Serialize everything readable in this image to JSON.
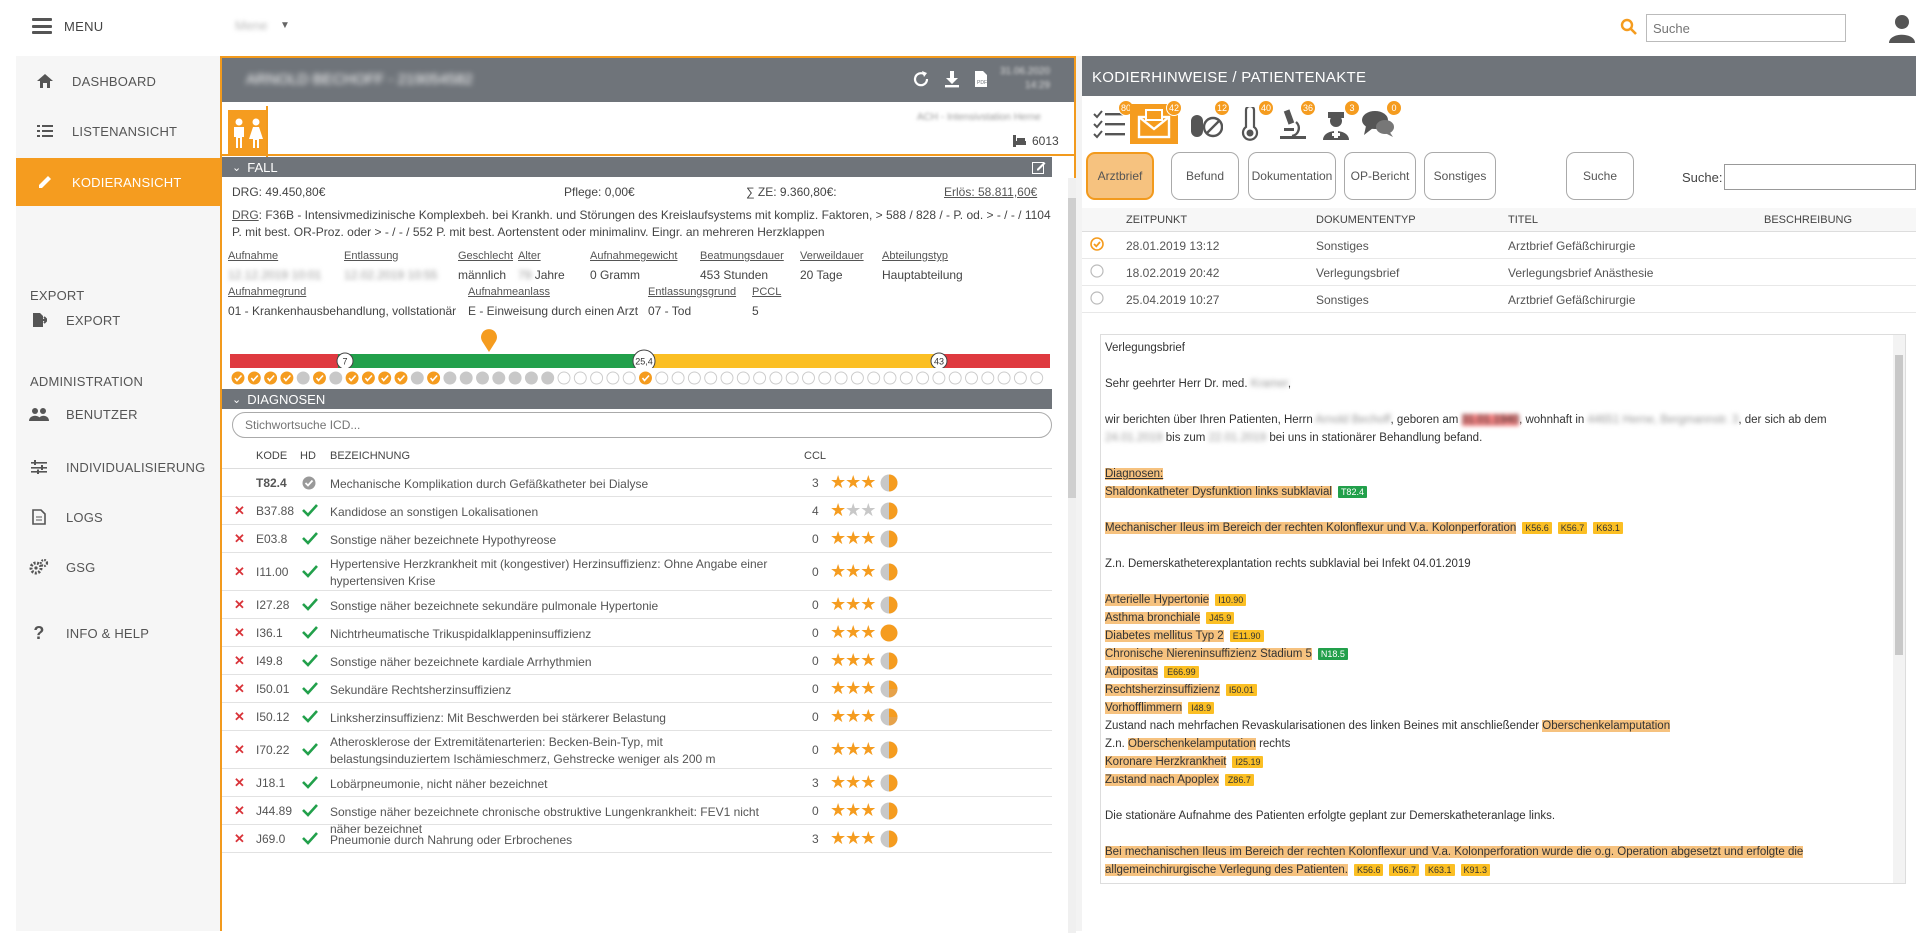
{
  "topbar": {
    "menu_label": "MENU",
    "tenant": "Mene",
    "search_placeholder": "Suche"
  },
  "sidebar": {
    "items": [
      {
        "label": "DASHBOARD",
        "icon": "home-icon"
      },
      {
        "label": "LISTENANSICHT",
        "icon": "list-icon"
      },
      {
        "label": "KODIERANSICHT",
        "icon": "pencil-icon"
      }
    ],
    "export_section": "EXPORT",
    "export_item": "EXPORT",
    "admin_section": "ADMINISTRATION",
    "admin_items": [
      {
        "label": "BENUTZER",
        "icon": "users-icon"
      },
      {
        "label": "INDIVIDUALISIERUNG",
        "icon": "sliders-icon"
      },
      {
        "label": "LOGS",
        "icon": "document-icon"
      },
      {
        "label": "GSG",
        "icon": "gears-icon"
      }
    ],
    "info_item": "INFO & HELP"
  },
  "patient": {
    "name": "ARNOLD BECHOFF - 219054582",
    "date": "31.06.2020",
    "time": "14:29",
    "station": "ACH - Intensivstation Herne",
    "bed": "6013"
  },
  "fall": {
    "section_title": "FALL",
    "drg": "DRG: 49.450,80€",
    "pflege": "Pflege: 0,00€",
    "ze": "∑ ZE: 9.360,80€:",
    "erloes": "Erlös: 58.811,60€",
    "drg_prefix": "DRG",
    "drg_desc": ": F36B - Intensivmedizinische Komplexbeh. bei Krankh. und Störungen des Kreislaufsystems mit kompliz. Faktoren, > 588 / 828 / - P. od. > - / - / 1104 P. mit best. OR-Proz. oder > - / - / 552 P. mit best. Aortenstent oder minimalinv. Eingr. an mehreren Herzklappen",
    "fields": [
      {
        "label": "Aufnahme",
        "value": "12.12.2019 10:01"
      },
      {
        "label": "Entlassung",
        "value": "12.02.2019 10:55"
      },
      {
        "label": "Geschlecht",
        "value": "männlich"
      },
      {
        "label": "Alter",
        "value": "79"
      },
      {
        "label": "Aufnahmegewicht",
        "value": "0 Gramm"
      },
      {
        "label": "Beatmungsdauer",
        "value": "453 Stunden"
      },
      {
        "label": "Verweildauer",
        "value": "20 Tage"
      },
      {
        "label": "Abteilungstyp",
        "value": "Hauptabteilung"
      },
      {
        "label": "Aufnahmegrund",
        "value": "01 - Krankenhausbehandlung, vollstationär"
      },
      {
        "label": "Aufnahmeanlass",
        "value": "E - Einweisung durch einen Arzt"
      },
      {
        "label": "Entlassungsgrund",
        "value": "07 - Tod"
      },
      {
        "label": "PCCL",
        "value": "5"
      }
    ],
    "age_unit": "Jahre",
    "scale": {
      "low": "7",
      "mid": "25,4",
      "high": "43",
      "marker_day": 20
    }
  },
  "diagnosen": {
    "section_title": "DIAGNOSEN",
    "search_placeholder": "Stichwortsuche ICD...",
    "headers": [
      "KODE",
      "HD",
      "BEZEICHNUNG",
      "CCL"
    ],
    "rows": [
      {
        "code": "T82.4",
        "desc": "Mechanische Komplikation durch Gefäßkatheter bei Dialyse",
        "ccl": "3",
        "stars": 3,
        "hd": true
      },
      {
        "code": "B37.88",
        "desc": "Kandidose an sonstigen Lokalisationen",
        "ccl": "4",
        "stars": 1
      },
      {
        "code": "E03.8",
        "desc": "Sonstige näher bezeichnete Hypothyreose",
        "ccl": "0",
        "stars": 3
      },
      {
        "code": "I11.00",
        "desc": "Hypertensive Herzkrankheit mit (kongestiver) Herzinsuffizienz: Ohne Angabe einer hypertensiven Krise",
        "ccl": "0",
        "stars": 3
      },
      {
        "code": "I27.28",
        "desc": "Sonstige näher bezeichnete sekundäre pulmonale Hypertonie",
        "ccl": "0",
        "stars": 3
      },
      {
        "code": "I36.1",
        "desc": "Nichtrheumatische Trikuspidalklappeninsuffizienz",
        "ccl": "0",
        "stars": 3
      },
      {
        "code": "I49.8",
        "desc": "Sonstige näher bezeichnete kardiale Arrhythmien",
        "ccl": "0",
        "stars": 3
      },
      {
        "code": "I50.01",
        "desc": "Sekundäre Rechtsherzinsuffizienz",
        "ccl": "0",
        "stars": 3
      },
      {
        "code": "I50.12",
        "desc": "Linksherzinsuffizienz: Mit Beschwerden bei stärkerer Belastung",
        "ccl": "0",
        "stars": 3
      },
      {
        "code": "I70.22",
        "desc": "Atherosklerose der Extremitätenarterien: Becken-Bein-Typ, mit belastungsinduziertem Ischämieschmerz, Gehstrecke weniger als 200 m",
        "ccl": "0",
        "stars": 3
      },
      {
        "code": "J18.1",
        "desc": "Lobärpneumonie, nicht näher bezeichnet",
        "ccl": "3",
        "stars": 3
      },
      {
        "code": "J44.89",
        "desc": "Sonstige näher bezeichnete chronische obstruktive Lungenkrankheit: FEV1 nicht näher bezeichnet",
        "ccl": "0",
        "stars": 3
      },
      {
        "code": "J69.0",
        "desc": "Pneumonie durch Nahrung oder Erbrochenes",
        "ccl": "3",
        "stars": 3
      }
    ]
  },
  "kodierhinweise": {
    "title": "KODIERHINWEISE / PATIENTENAKTE",
    "icon_badges": [
      "80",
      "42",
      "12",
      "40",
      "36",
      "3",
      "0"
    ],
    "tabs": [
      "Arztbrief",
      "Befund",
      "Dokumentation",
      "OP-Bericht",
      "Sonstiges",
      "Suche"
    ],
    "search_label": "Suche:",
    "headers": [
      "ZEITPUNKT",
      "DOKUMENTENTYP",
      "TITEL",
      "BESCHREIBUNG"
    ],
    "docs": [
      {
        "time": "28.01.2019 13:12",
        "type": "Sonstiges",
        "title": "Arztbrief Gefäßchirurgie",
        "checked": true
      },
      {
        "time": "18.02.2019 20:42",
        "type": "Verlegungsbrief",
        "title": "Verlegungsbrief Anästhesie",
        "checked": false
      },
      {
        "time": "25.04.2019 10:27",
        "type": "Sonstiges",
        "title": "Arztbrief Gefäßchirurgie",
        "checked": false
      }
    ]
  },
  "letter": {
    "heading": "Verlegungsbrief",
    "salutation": "Sehr geehrter Herr Dr. med.",
    "salutation_name": "Kramer",
    "intro_a": "wir berichten über Ihren Patienten, Herrn",
    "intro_name": "Arnold Bechoff",
    "intro_b": ", geboren am",
    "intro_dob": "31.01.1940",
    "intro_c": ", wohnhaft in",
    "intro_addr": "44651 Herne, Bergmannstr. 3",
    "intro_d": ", der sich ab dem",
    "intro_from": "24.01.2019",
    "intro_e": "bis zum",
    "intro_to": "22.01.2019",
    "intro_f": "bei uns in stationärer Behandlung befand.",
    "diag_heading": "Diagnosen:",
    "d1": "Shaldonkatheter Dysfunktion links subklavial",
    "d1_codes": [
      "T82.4"
    ],
    "d2": "Mechanischer Ileus im Bereich der rechten Kolonflexur und V.a. Kolonperforation",
    "d2_codes": [
      "K56.6",
      "K56.7",
      "K63.1"
    ],
    "d3": "Z.n. Demerskatheterexplantation rechts subklavial bei Infekt 04.01.2019",
    "list": [
      {
        "text": "Arterielle Hypertonie",
        "code": "I10.90",
        "green": false
      },
      {
        "text": "Asthma bronchiale",
        "code": "J45.9",
        "green": false
      },
      {
        "text": "Diabetes mellitus Typ 2",
        "code": "E11.90",
        "green": false
      },
      {
        "text": "Chronische Niereninsuffizienz Stadium 5",
        "code": "N18.5",
        "green": true
      },
      {
        "text": "Adipositas",
        "code": "E66.99",
        "green": false
      },
      {
        "text": "Rechtsherzinsuffizienz",
        "code": "I50.01",
        "green": false
      },
      {
        "text": "Vorhofflimmern",
        "code": "I48.9",
        "green": false
      }
    ],
    "zustand_a": "Zustand nach mehrfachen Revaskularisationen des linken Beines mit anschließender",
    "zustand_hl": "Oberschenkelamputation",
    "zn_a": "Z.n.",
    "zn_hl": "Oberschenkelamputation",
    "zn_b": "rechts",
    "khk": "Koronare Herzkrankheit",
    "khk_code": "I25.19",
    "apo": "Zustand nach Apoplex",
    "apo_code": "Z86.7",
    "aufnahme": "Die stationäre Aufnahme des Patienten erfolgte geplant zur Demerskatheteranlage links.",
    "last": "Bei mechanischen Ileus im Bereich der rechten Kolonflexur und V.a. Kolonperforation wurde die o.g. Operation abgesetzt und erfolgte die allgemeinchirurgische Verlegung des Patienten.",
    "last_codes": [
      "K56.6",
      "K56.7",
      "K63.1",
      "K91.3"
    ]
  },
  "colors": {
    "accent": "#f59c1f",
    "header": "#6f747a",
    "red": "#d9343a",
    "green": "#22a04b",
    "scale_yellow": "#fbbf24",
    "scale_red": "#df3a40"
  }
}
